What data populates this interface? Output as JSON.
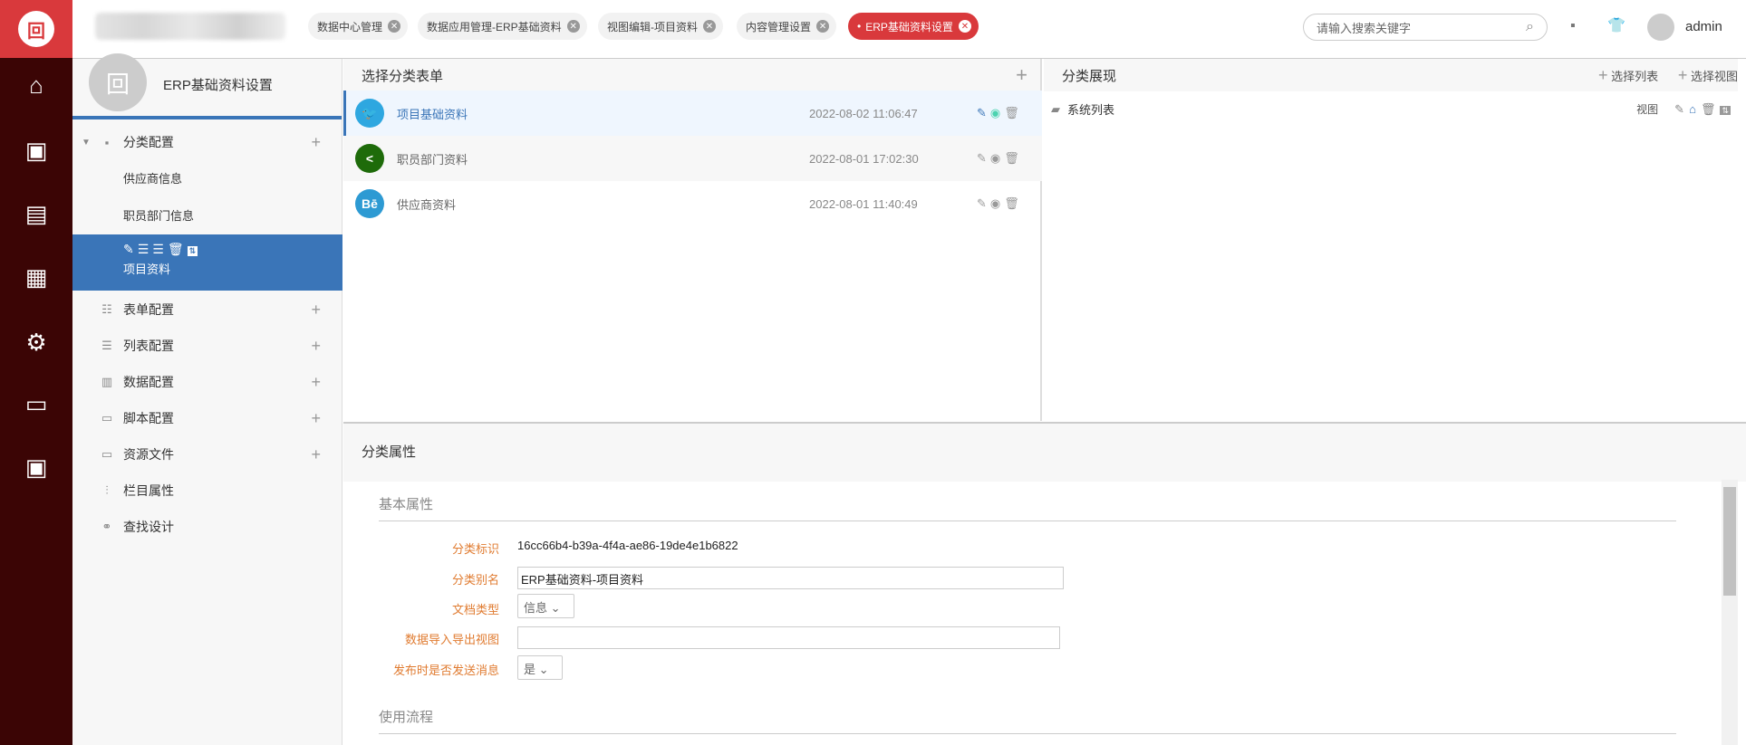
{
  "rail": {
    "items": [
      "home-icon",
      "user-screen-icon",
      "news-icon",
      "calendar-icon",
      "user-settings-icon",
      "monitor-flow-icon",
      "service-icon"
    ]
  },
  "tabs": [
    {
      "label": "数据中心管理",
      "active": false
    },
    {
      "label": "数据应用管理-ERP基础资料",
      "active": false
    },
    {
      "label": "视图编辑-项目资料",
      "active": false
    },
    {
      "label": "内容管理设置",
      "active": false
    },
    {
      "label": "ERP基础资料设置",
      "active": true
    }
  ],
  "search": {
    "placeholder": "请输入搜索关键字"
  },
  "user": {
    "name": "admin"
  },
  "sidebar": {
    "title": "ERP基础资料设置",
    "group": {
      "label": "分类配置",
      "children": [
        "供应商信息",
        "职员部门信息"
      ],
      "selected": "项目资料"
    },
    "items": [
      {
        "label": "表单配置",
        "plus": true
      },
      {
        "label": "列表配置",
        "plus": true
      },
      {
        "label": "数据配置",
        "plus": true
      },
      {
        "label": "脚本配置",
        "plus": true
      },
      {
        "label": "资源文件",
        "plus": true
      },
      {
        "label": "栏目属性",
        "plus": false
      },
      {
        "label": "查找设计",
        "plus": false
      }
    ]
  },
  "forms": {
    "title": "选择分类表单",
    "rows": [
      {
        "name": "项目基础资料",
        "date": "2022-08-02 11:06:47",
        "icon": "twitter-icon",
        "color": "#2ea7e0"
      },
      {
        "name": "职员部门资料",
        "date": "2022-08-01 17:02:30",
        "icon": "share-icon",
        "color": "#1e6b0a"
      },
      {
        "name": "供应商资料",
        "date": "2022-08-01 11:40:49",
        "icon": "behance-icon",
        "color": "#2d9ad3"
      }
    ]
  },
  "display": {
    "title": "分类展现",
    "select_list": "选择列表",
    "select_view": "选择视图",
    "row": {
      "name": "系统列表",
      "type": "视图"
    }
  },
  "props": {
    "title": "分类属性",
    "basic": "基本属性",
    "flow": "使用流程",
    "fields": {
      "id_label": "分类标识",
      "id_value": "16cc66b4-b39a-4f4a-ae86-19de4e1b6822",
      "alias_label": "分类别名",
      "alias_value": "ERP基础资料-项目资料",
      "doctype_label": "文档类型",
      "doctype_value": "信息",
      "io_label": "数据导入导出视图",
      "io_value": "",
      "notify_label": "发布时是否发送消息",
      "notify_value": "是"
    }
  }
}
